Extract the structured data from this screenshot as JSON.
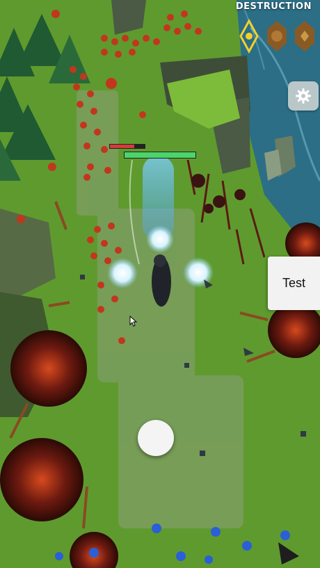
{
  "hud": {
    "mode_label": "DESTRUCTION",
    "runes": [
      {
        "name": "rune-yellow",
        "color": "#f2d02a",
        "active": true
      },
      {
        "name": "rune-bronze-1",
        "color": "#9c6a2e",
        "active": false
      },
      {
        "name": "rune-bronze-2",
        "color": "#9c6a2e",
        "active": false
      }
    ]
  },
  "buttons": {
    "settings_icon": "gear-icon",
    "test_label": "Test",
    "joystick": "virtual-joystick"
  },
  "player": {
    "health_bar_fill": 1.0,
    "health_color": "#4bd46a"
  },
  "enemy": {
    "health_bar_fill": 0.7,
    "health_color": "#d43c3c"
  },
  "colors": {
    "grass": "#5f9a2e",
    "water": "#2b6e86",
    "enemy_red": "#c2361e",
    "ally_blue": "#2a5fd8",
    "magic": "#8fd8ff"
  }
}
